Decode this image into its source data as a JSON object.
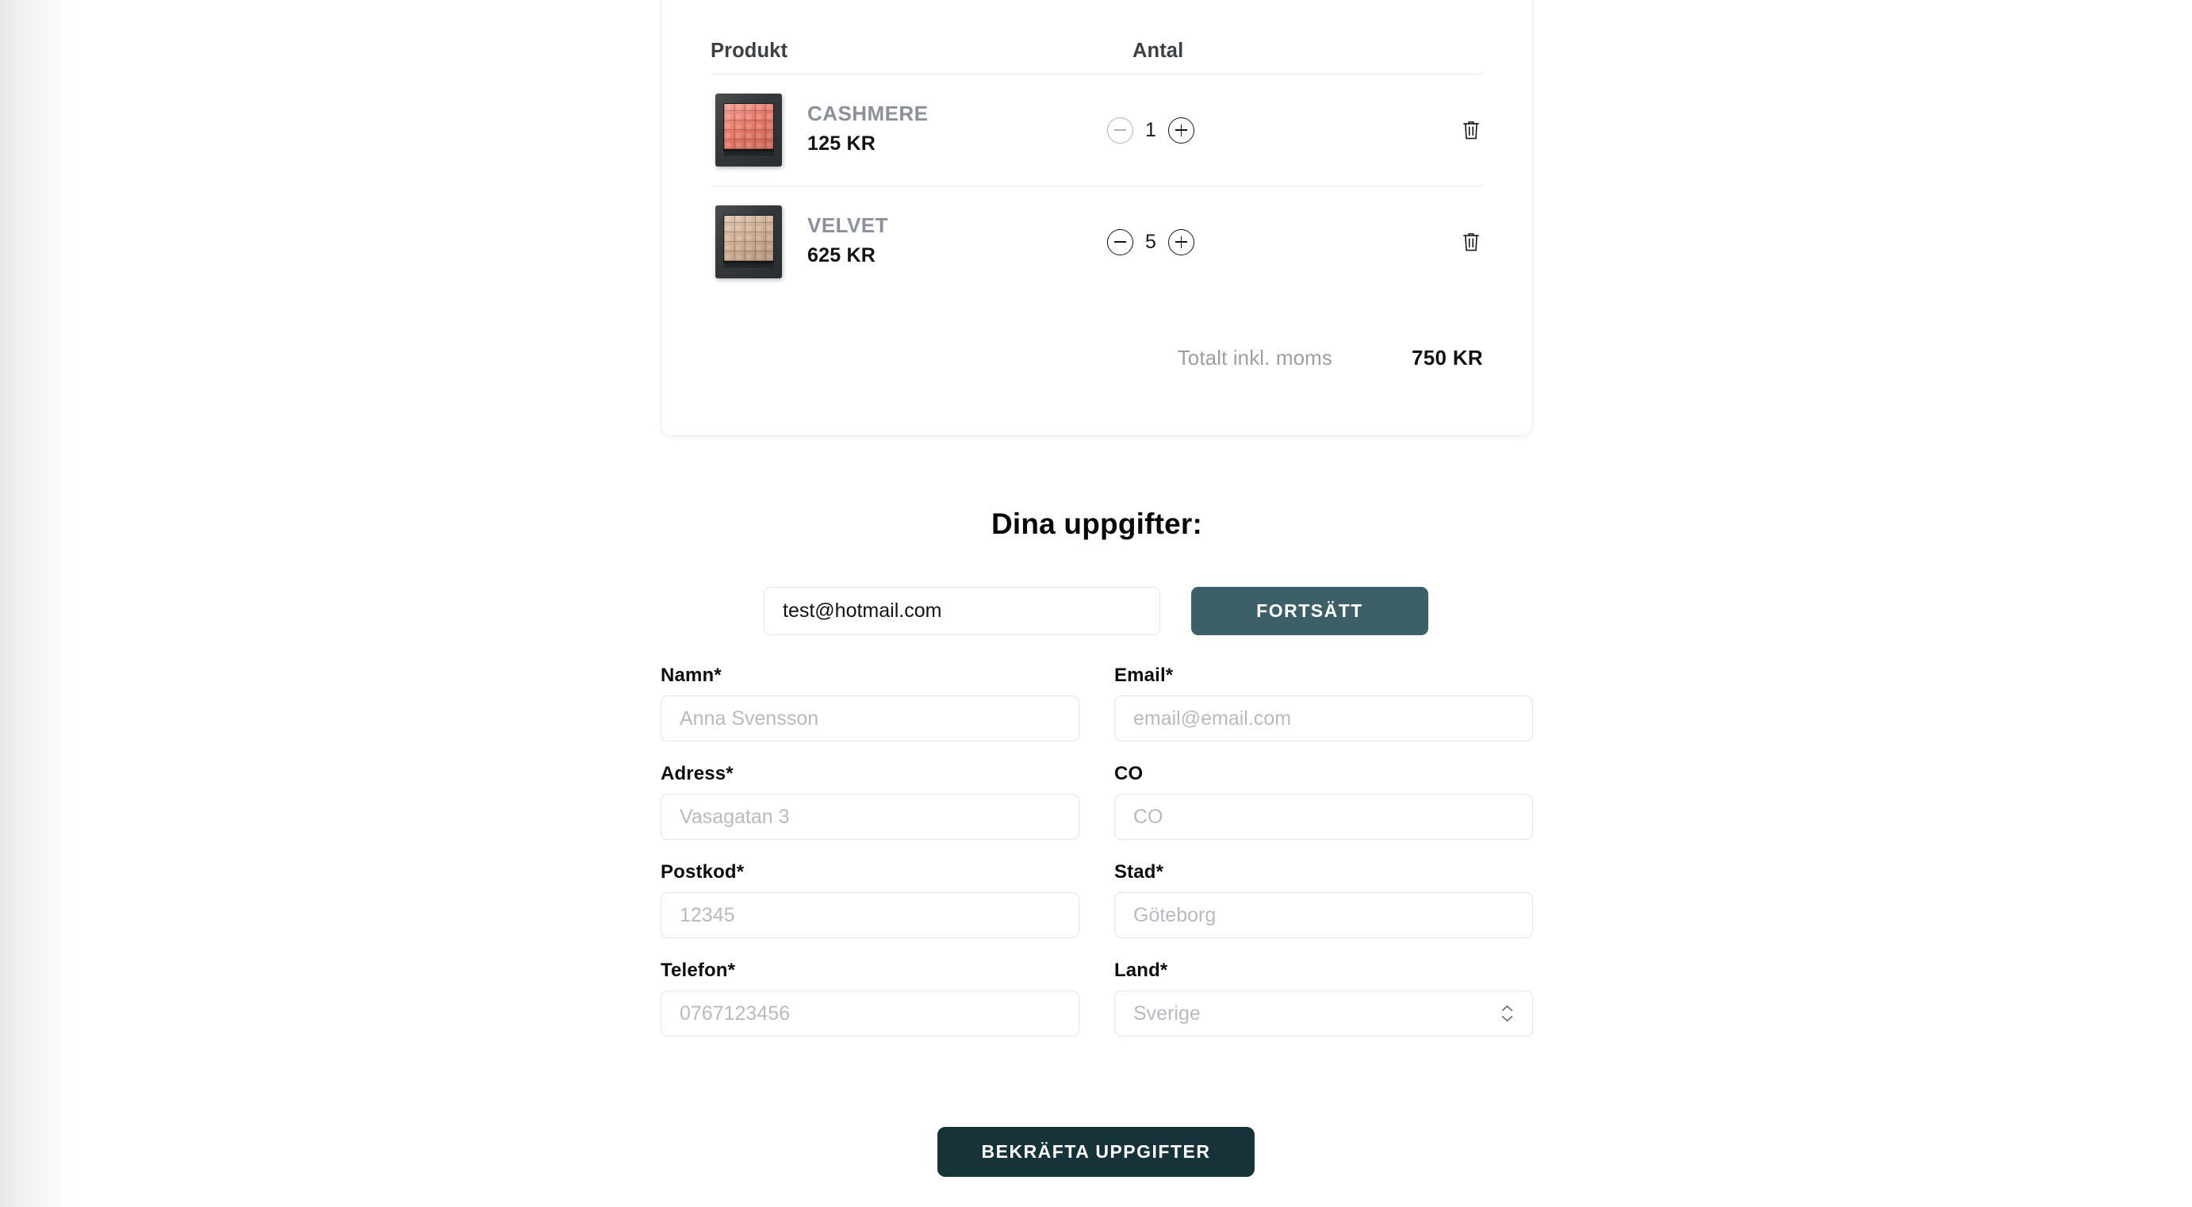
{
  "cart": {
    "columns": {
      "product": "Produkt",
      "quantity": "Antal"
    },
    "items": [
      {
        "name": "CASHMERE",
        "price": "125 KR",
        "quantity": "1",
        "decrement_disabled": true,
        "pan_color": "#e2705f",
        "pan_color_light": "#f09486",
        "thumb_icon": "product-thumbnail-cashmere",
        "decrement_icon": "minus-circle-icon",
        "increment_icon": "plus-circle-icon",
        "remove_icon": "trash-icon"
      },
      {
        "name": "VELVET",
        "price": "625 KR",
        "quantity": "5",
        "decrement_disabled": false,
        "pan_color": "#c9a78c",
        "pan_color_light": "#ddc0a8",
        "thumb_icon": "product-thumbnail-velvet",
        "decrement_icon": "minus-circle-icon",
        "increment_icon": "plus-circle-icon",
        "remove_icon": "trash-icon"
      }
    ],
    "total_label": "Totalt inkl. moms",
    "total_value": "750 KR"
  },
  "details": {
    "heading": "Dina uppgifter:",
    "email_quick": {
      "value": "test@hotmail.com",
      "placeholder": "email@email.com"
    },
    "continue_label": "FORTSÄTT",
    "fields": [
      {
        "label": "Namn*",
        "placeholder": "Anna Svensson",
        "value": "",
        "type": "text",
        "name": "name-field"
      },
      {
        "label": "Email*",
        "placeholder": "email@email.com",
        "value": "",
        "type": "email",
        "name": "email-field"
      },
      {
        "label": "Adress*",
        "placeholder": "Vasagatan 3",
        "value": "",
        "type": "text",
        "name": "address-field"
      },
      {
        "label": "CO",
        "placeholder": "CO",
        "value": "",
        "type": "text",
        "name": "co-field"
      },
      {
        "label": "Postkod*",
        "placeholder": "12345",
        "value": "",
        "type": "text",
        "name": "postcode-field"
      },
      {
        "label": "Stad*",
        "placeholder": "Göteborg",
        "value": "",
        "type": "text",
        "name": "city-field"
      },
      {
        "label": "Telefon*",
        "placeholder": "0767123456",
        "value": "",
        "type": "tel",
        "name": "phone-field"
      },
      {
        "label": "Land*",
        "placeholder": "Sverige",
        "value": "",
        "type": "select",
        "name": "country-select",
        "options": [
          "Sverige"
        ]
      }
    ],
    "confirm_label": "BEKRÄFTA UPPGIFTER",
    "select_icon": "chevron-up-down-icon"
  },
  "colors": {
    "continue_button": "#3d6068",
    "confirm_button": "#16333a",
    "product_name": "#8b909a",
    "muted_text": "#9aa0a6"
  }
}
